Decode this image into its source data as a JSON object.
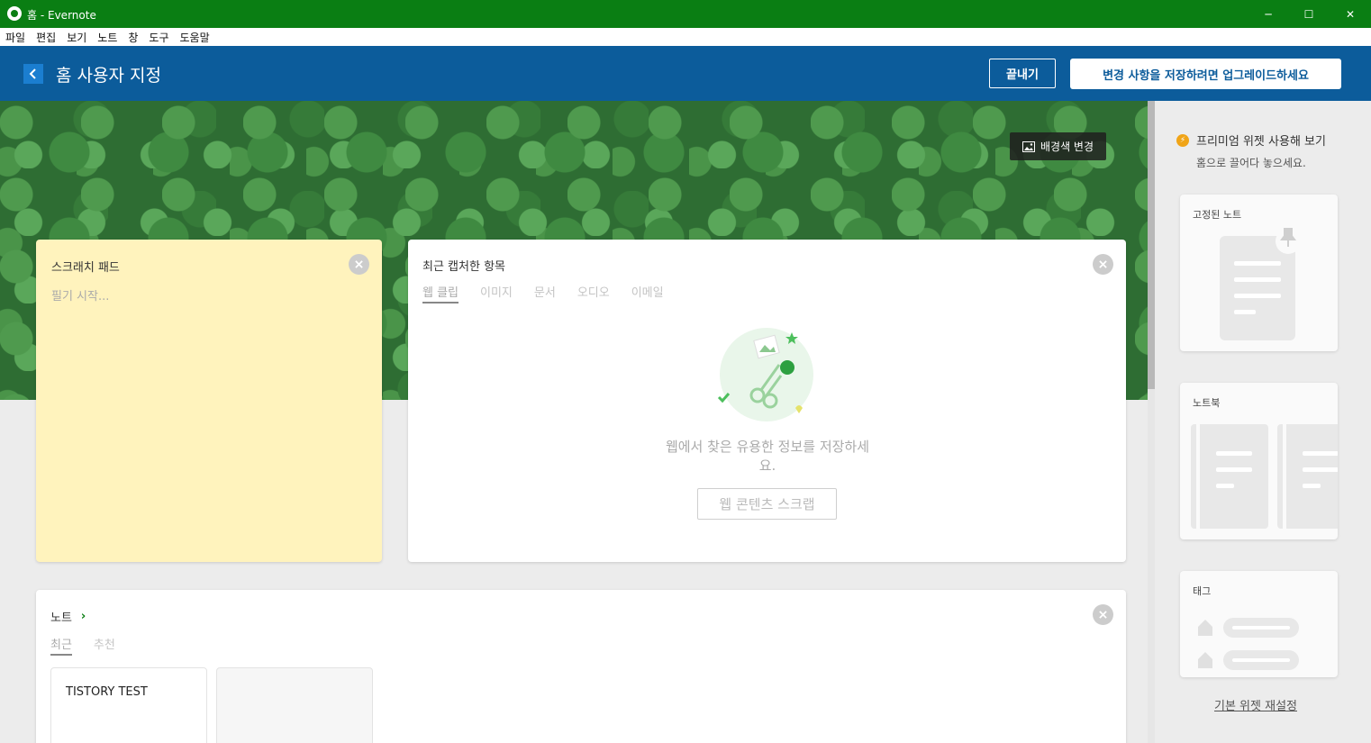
{
  "window": {
    "title": "홈 - Evernote",
    "controls": {
      "minimize": "─",
      "maximize": "☐",
      "close": "✕"
    }
  },
  "menu": [
    "파일",
    "편집",
    "보기",
    "노트",
    "창",
    "도구",
    "도움말"
  ],
  "header": {
    "title": "홈 사용자 지정",
    "done_label": "끝내기",
    "upgrade_label": "변경 사항을 저장하려면 업그레이드하세요"
  },
  "banner": {
    "change_bg_label": "배경색 변경"
  },
  "scratchpad": {
    "title": "스크래치 패드",
    "placeholder": "필기 시작..."
  },
  "recent": {
    "title": "최근 캡처한 항목",
    "tabs": [
      "웹 클립",
      "이미지",
      "문서",
      "오디오",
      "이메일"
    ],
    "active_tab": "웹 클립",
    "empty_message": "웹에서 찾은 유용한 정보를 저장하세요.",
    "clip_button": "웹 콘텐츠 스크랩"
  },
  "notes": {
    "title": "노트",
    "tabs": [
      "최근",
      "추천"
    ],
    "active_tab": "최근",
    "cards": [
      {
        "title": "TISTORY TEST"
      }
    ]
  },
  "sidebar": {
    "premium_title": "프리미엄 위젯 사용해 보기",
    "premium_subtitle": "홈으로 끌어다 놓으세요.",
    "widgets": [
      "고정된 노트",
      "노트북",
      "태그"
    ],
    "reset_label": "기본 위젯 재설정"
  },
  "colors": {
    "titlebar": "#0a7e13",
    "header": "#0c5c9b",
    "scratchpad": "#fff3bd",
    "premium": "#f0a417"
  }
}
